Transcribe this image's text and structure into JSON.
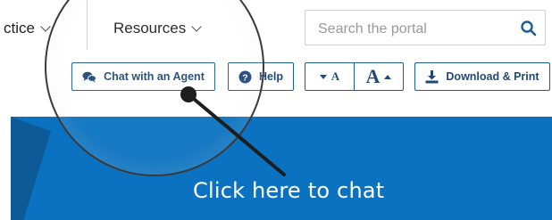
{
  "nav": {
    "practice_label": "ctice",
    "resources_label": "Resources"
  },
  "search": {
    "placeholder": "Search the portal",
    "value": ""
  },
  "toolbar": {
    "chat_label": "Chat with an Agent",
    "help_label": "Help",
    "font_small_label": "A",
    "font_large_label": "A",
    "download_label": "Download & Print"
  },
  "annotation": {
    "caption": "Click here to chat"
  },
  "icons": {
    "chat": "chat-bubbles-icon",
    "help": "question-circle-icon",
    "download": "download-icon",
    "search": "search-icon"
  },
  "colors": {
    "accent": "#1a5e9c",
    "banner": "#0a72c0",
    "banner_dark": "#0c5a98"
  }
}
